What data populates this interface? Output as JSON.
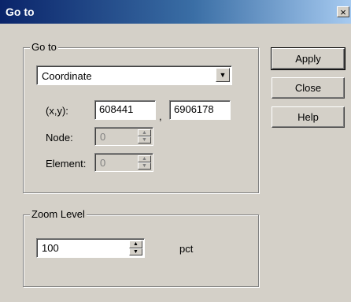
{
  "window": {
    "title": "Go to",
    "close_glyph": "×"
  },
  "goto_group": {
    "legend": "Go to",
    "mode_selected": "Coordinate",
    "xy_label": "(x,y):",
    "x_value": "608441",
    "comma": ",",
    "y_value": "6906178",
    "node_label": "Node:",
    "node_value": "0",
    "element_label": "Element:",
    "element_value": "0"
  },
  "zoom_group": {
    "legend": "Zoom Level",
    "value": "100",
    "unit": "pct"
  },
  "buttons": {
    "apply": "Apply",
    "close": "Close",
    "help": "Help"
  },
  "icons": {
    "dropdown": "chevron-down-icon",
    "spin_up": "triangle-up-icon",
    "spin_down": "triangle-down-icon",
    "close": "close-icon"
  }
}
